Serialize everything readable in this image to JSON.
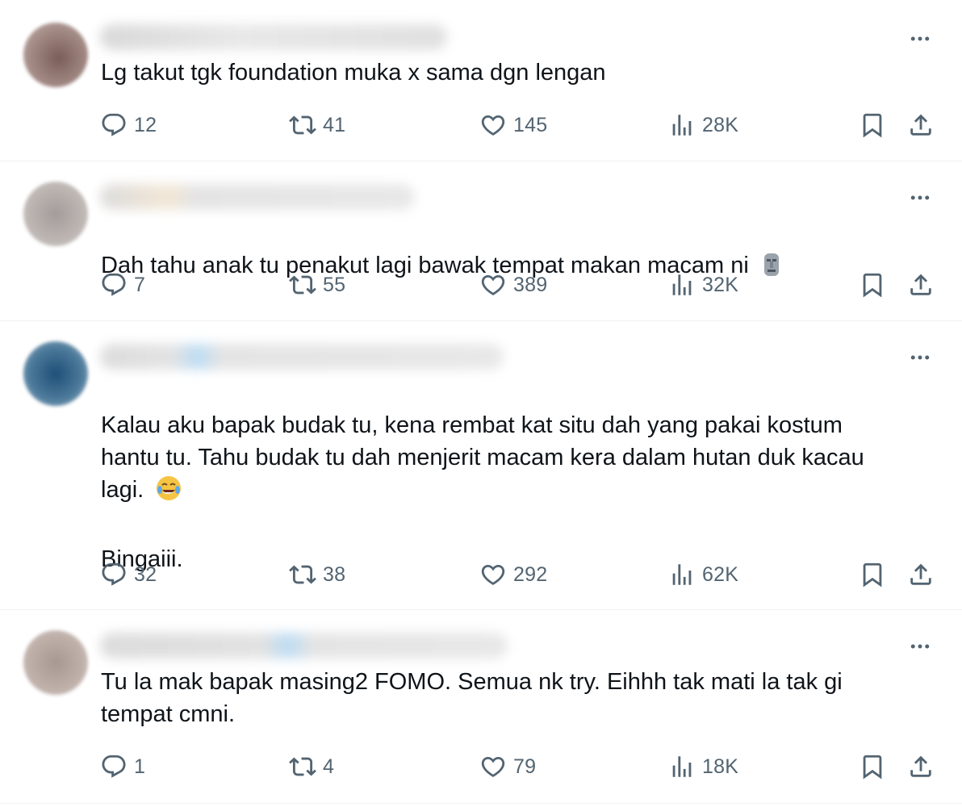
{
  "replies": [
    {
      "text": "Lg takut tgk foundation muka x sama dgn lengan",
      "emoji": "",
      "stats": {
        "replies": "12",
        "reposts": "41",
        "likes": "145",
        "views": "28K"
      }
    },
    {
      "text": "Dah tahu anak tu penakut lagi bawak tempat makan macam ni ",
      "emoji": "moai-icon",
      "stats": {
        "replies": "7",
        "reposts": "55",
        "likes": "389",
        "views": "32K"
      }
    },
    {
      "text": "Kalau aku bapak budak tu, kena rembat kat situ dah yang pakai kostum\nhantu tu. Tahu budak tu dah menjerit macam kera dalam hutan duk kacau\nlagi. ",
      "text_after": "Bingaiii.",
      "emoji": "tears-of-joy-icon",
      "stats": {
        "replies": "32",
        "reposts": "38",
        "likes": "292",
        "views": "62K"
      }
    },
    {
      "text": "Tu la mak bapak masing2 FOMO. Semua nk try. Eihhh tak mati la tak gi\ntempat cmni.",
      "emoji": "",
      "stats": {
        "replies": "1",
        "reposts": "4",
        "likes": "79",
        "views": "18K"
      }
    }
  ],
  "colors": {
    "text": "#0f1419",
    "secondary": "#536471",
    "divider": "#eff3f4"
  }
}
